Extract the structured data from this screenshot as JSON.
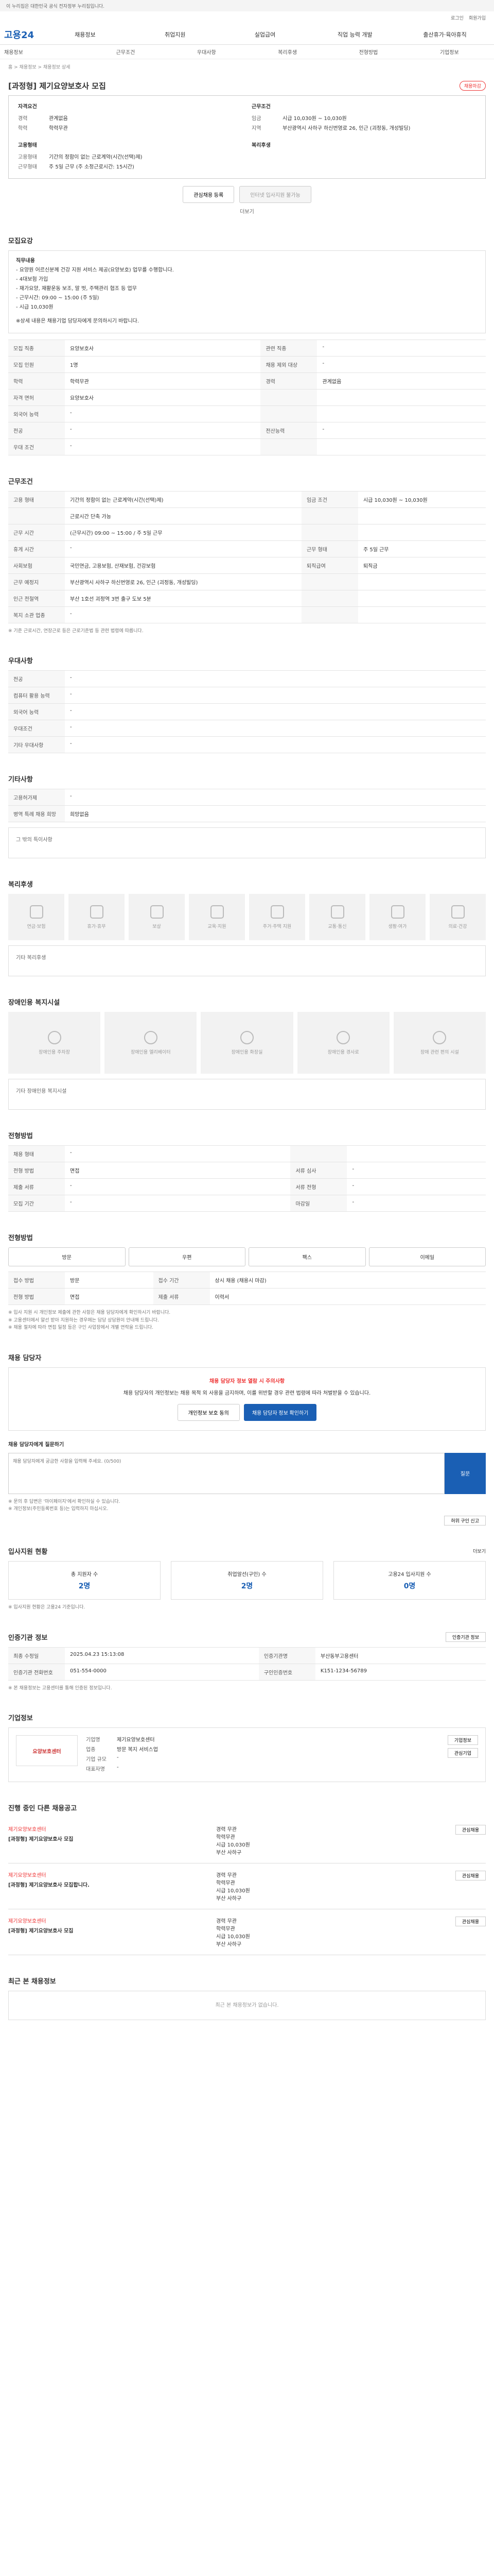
{
  "topbar": {
    "text": "이 누리집은 대한민국 공식 전자정부 누리집입니다."
  },
  "utility": {
    "login": "로그인",
    "join": "회원가입"
  },
  "brand": {
    "logo": "고용24"
  },
  "gnb": [
    "채용정보",
    "취업지원",
    "실업급여",
    "직업 능력 개발",
    "출산휴가·육아휴직"
  ],
  "subnav": [
    "채용정보",
    "근무조건",
    "우대사항",
    "복리후생",
    "전형방법",
    "기업정보"
  ],
  "breadcrumb": "홈 > 채용정보 > 채용정보 상세",
  "job": {
    "title": "[과정형] 제기요양보호사 모집",
    "status": "채용마감",
    "summary_left_title": "자격요건",
    "summary_left": [
      {
        "k": "경력",
        "v": "관계없음"
      },
      {
        "k": "학력",
        "v": "학력무관"
      }
    ],
    "summary_right_title": "근무조건",
    "summary_right": [
      {
        "k": "임금",
        "v": "시급 10,030원 ~ 10,030원"
      },
      {
        "k": "지역",
        "v": "부산광역시 사하구 하신번영로 26, 인근 (괴정동, 개성빌딩)"
      }
    ],
    "form_title": "고용형태",
    "form_list": [
      {
        "k": "고용형태",
        "v": "기간의 정함이 없는 근로계약(시간(선택)제)"
      },
      {
        "k": "근무형태",
        "v": "주 5일 근무 (주 소정근로시간: 15시간)"
      }
    ],
    "bene_title": "복리후생",
    "btn_scrap": "관심채용 등록",
    "btn_apply": "인터넷 입사지원 불가능",
    "view_more": "더보기"
  },
  "recruit": {
    "title": "모집요강",
    "lines": [
      "직무내용",
      "- 요양원 어르신분께 건강 지원 서비스 제공(요양보호) 업무를 수행합니다.",
      "- 4대보험 가입",
      "- 재가요양, 재활운동 보조, 말 벗, 주택관리 협조 등 업무",
      "- 근무시간: 09:00 ~ 15:00 (주 5일)",
      "- 시급 10,030원",
      "※상세 내용은 채용기업 담당자에게 문의하시기 바랍니다."
    ],
    "rows": [
      {
        "k": "모집 직종",
        "v": "요양보호사",
        "k2": "관련 직종",
        "v2": "-"
      },
      {
        "k": "모집 인원",
        "v": "1명",
        "k2": "채용 제외 대상",
        "v2": "-"
      },
      {
        "k": "학력",
        "v": "학력무관",
        "k2": "경력",
        "v2": "관계없음"
      },
      {
        "k": "자격 면허",
        "v": "요양보호사",
        "k2": "",
        "v2": ""
      },
      {
        "k": "외국어 능력",
        "v": "-",
        "k2": "",
        "v2": ""
      },
      {
        "k": "전공",
        "v": "-",
        "k2": "전산능력",
        "v2": "-"
      },
      {
        "k": "우대 조건",
        "v": "-",
        "k2": "",
        "v2": ""
      }
    ]
  },
  "work": {
    "title": "근무조건",
    "rows": [
      {
        "k": "고용 형태",
        "v": "기간의 정함이 없는 근로계약(시간(선택)제)",
        "k2": "임금 조건",
        "v2": "시급 10,030원 ~ 10,030원"
      },
      {
        "k": "",
        "v": "근로시간 단축 가능",
        "k2": "",
        "v2": ""
      },
      {
        "k": "근무 시간",
        "v": "(근무시간) 09:00 ~ 15:00 / 주 5일 근무",
        "k2": "",
        "v2": ""
      },
      {
        "k": "휴게 시간",
        "v": "-",
        "k2": "근무 형태",
        "v2": "주 5일 근무"
      },
      {
        "k": "사회보험",
        "v": "국민연금, 고용보험, 산재보험, 건강보험",
        "k2": "퇴직급여",
        "v2": "퇴직금"
      },
      {
        "k": "근무 예정지",
        "v": "부산광역시 사하구 하신번영로 26, 인근 (괴정동, 개성빌딩)",
        "k2": "",
        "v2": ""
      },
      {
        "k": "인근 전철역",
        "v": "부산 1호선 괴정역 3번 출구 도보 5분",
        "k2": "",
        "v2": ""
      },
      {
        "k": "복지 소관 업종",
        "v": "-",
        "k2": "",
        "v2": ""
      }
    ],
    "map_btn": "지도 보기",
    "note": "※ 기준 근로시간, 연장근로 등은 근로기준법 등 관련 법령에 따릅니다."
  },
  "pref": {
    "title": "우대사항",
    "rows": [
      {
        "k": "전공",
        "v": "-"
      },
      {
        "k": "컴퓨터 활용 능력",
        "v": "-"
      },
      {
        "k": "외국어 능력",
        "v": "-"
      },
      {
        "k": "우대조건",
        "v": "-"
      },
      {
        "k": "기타 우대사항",
        "v": "-"
      }
    ]
  },
  "other": {
    "title": "기타사항",
    "rows": [
      {
        "k": "고용허가제",
        "v": "-"
      },
      {
        "k": "병역 특례 채용 희망",
        "v": "희망없음"
      }
    ],
    "extra": "그 밖의 특이사항"
  },
  "benefit": {
    "title": "복리후생",
    "items": [
      "연금·보험",
      "휴가·휴무",
      "보상",
      "교육·지원",
      "주거·주택 지원",
      "교통·통신",
      "생활·여가",
      "의료·건강"
    ],
    "extra_label": "기타 복리후생"
  },
  "disabled": {
    "title": "장애인용 복지시설",
    "items": [
      "장애인용 주차장",
      "장애인용 엘리베이터",
      "장애인용 화장실",
      "장애인용 경사로",
      "장애 관련 편의 시설"
    ],
    "extra_label": "기타 장애인용 복지시설"
  },
  "selection": {
    "title": "전형방법",
    "rows": [
      {
        "k": "채용 형태",
        "v": "-",
        "k2": "",
        "v2": ""
      },
      {
        "k": "전형 방법",
        "v": "면접",
        "k2": "서류 심사",
        "v2": "-"
      },
      {
        "k": "제출 서류",
        "v": "-",
        "k2": "서류 전형",
        "v2": "-"
      },
      {
        "k": "모집 기간",
        "v": "-",
        "k2": "마감일",
        "v2": "-"
      }
    ]
  },
  "apply": {
    "title": "전형방법",
    "methods": [
      "방문",
      "우편",
      "팩스",
      "이메일"
    ],
    "rows": [
      {
        "k": "접수 방법",
        "v": "방문",
        "k2": "접수 기간",
        "v2": "상시 채용 (채용시 마감)"
      },
      {
        "k": "전형 방법",
        "v": "면접",
        "k2": "제출 서류",
        "v2": "이력서"
      }
    ],
    "notes": [
      "※ 입사 지원 시 개인정보 제출에 관한 사항은 채용 담당자에게 확인하시기 바랍니다.",
      "※ 고용센터에서 알선 받아 지원하는 경우에는 담당 상담원이 안내해 드립니다.",
      "※ 채용 절차에 따라 면접 일정 등은 구인 사업장에서 개별 연락을 드립니다."
    ]
  },
  "contact": {
    "title": "채용 담당자",
    "notice_title": "채용 담당자 정보 열람 시 주의사항",
    "notice_body": "채용 담당자의 개인정보는 채용 목적 외 사용을 금지하며, 이를 위반할 경우 관련 법령에 따라 처벌받을 수 있습니다.",
    "btn_check": "개인정보 보호 동의",
    "btn_view": "채용 담당자 정보 확인하기",
    "qa_title": "채용 담당자에게 질문하기",
    "qa_placeholder": "채용 담당자에게 궁금한 사항을 입력해 주세요. (0/500)",
    "qa_btn": "질문",
    "help": [
      "※ 문의 후 답변은 '마이페이지'에서 확인하실 수 있습니다.",
      "※ 개인정보(주민등록번호 등)는 입력하지 마십시오."
    ],
    "report_btn": "허위 구인 신고"
  },
  "stats": {
    "title": "입사지원 현황",
    "more": "더보기",
    "items": [
      {
        "label": "총 지원자 수",
        "value": "2명"
      },
      {
        "label": "취업알선(구인) 수",
        "value": "2명"
      },
      {
        "label": "고용24 입사지원 수",
        "value": "0명"
      }
    ],
    "note": "※ 입사지원 현황은 고용24 기준입니다."
  },
  "info": {
    "title": "인증기관 정보",
    "btn": "인증기관 정보",
    "rows": [
      {
        "k": "최종 수정일",
        "v": "2025.04.23 15:13:08",
        "k2": "인증기관명",
        "v2": "부산동부고용센터"
      },
      {
        "k": "인증기관 전화번호",
        "v": "051-554-0000",
        "k2": "구인인증번호",
        "v2": "K151-1234-56789"
      }
    ],
    "note": "※ 본 채용정보는 고용센터를 통해 인증된 정보입니다."
  },
  "company": {
    "title": "기업정보",
    "logo": "요양보호센터",
    "rows": [
      {
        "k": "기업명",
        "v": "제기요양보호센터"
      },
      {
        "k": "업종",
        "v": "방문 복지 서비스업"
      },
      {
        "k": "기업 규모",
        "v": "-"
      },
      {
        "k": "대표자명",
        "v": "-"
      }
    ],
    "btn_view": "기업정보",
    "btn_fav": "관심기업"
  },
  "others": {
    "title": "진행 중인 다른 채용공고",
    "items": [
      {
        "company": "제기요양보호센터",
        "title": "[과정형] 제기요양보호사 모집",
        "career": "경력 무관",
        "edu": "학력무관",
        "pay": "시급 10,030원",
        "place": "부산 사하구",
        "btn": "관심채용"
      },
      {
        "company": "제기요양보호센터",
        "title": "[과정형] 제기요양보호사 모집합니다.",
        "career": "경력 무관",
        "edu": "학력무관",
        "pay": "시급 10,030원",
        "place": "부산 사하구",
        "btn": "관심채용"
      },
      {
        "company": "제기요양보호센터",
        "title": "[과정형] 제기요양보호사 모집",
        "career": "경력 무관",
        "edu": "학력무관",
        "pay": "시급 10,030원",
        "place": "부산 사하구",
        "btn": "관심채용"
      }
    ]
  },
  "recent": {
    "title": "최근 본 채용정보",
    "empty": "최근 본 채용정보가 없습니다."
  }
}
